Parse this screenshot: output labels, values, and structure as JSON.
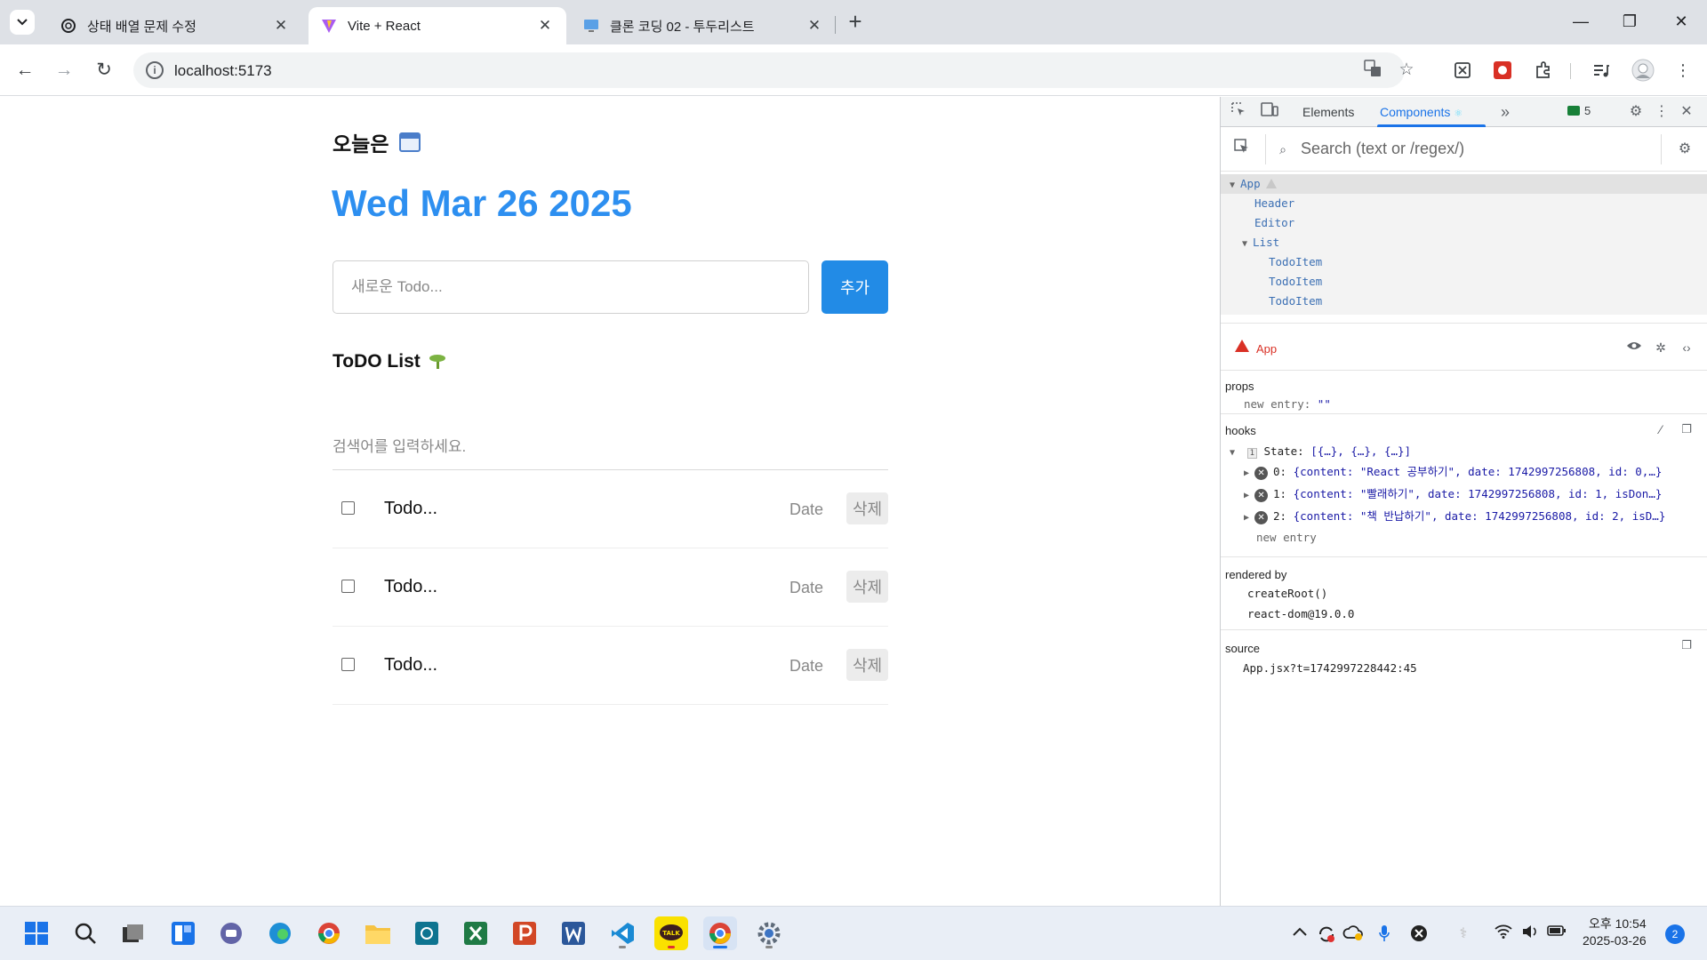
{
  "browser": {
    "tabs": [
      {
        "title": "상태 배열 문제 수정",
        "icon": "openai-icon"
      },
      {
        "title": "Vite + React",
        "icon": "vite-icon",
        "active": true
      },
      {
        "title": "클론 코딩 02 - 투두리스트",
        "icon": "monitor-icon"
      }
    ],
    "url": "localhost:5173"
  },
  "app": {
    "today_label": "오늘은",
    "date": "Wed Mar 26 2025",
    "editor": {
      "placeholder": "새로운 Todo...",
      "add_label": "추가"
    },
    "list_title": "ToDO List",
    "search_placeholder": "검색어를 입력하세요.",
    "todos": [
      {
        "content": "Todo...",
        "date": "Date",
        "delete_label": "삭제",
        "checked": false
      },
      {
        "content": "Todo...",
        "date": "Date",
        "delete_label": "삭제",
        "checked": false
      },
      {
        "content": "Todo...",
        "date": "Date",
        "delete_label": "삭제",
        "checked": false
      }
    ]
  },
  "devtools": {
    "tabs": [
      "Elements",
      "Components"
    ],
    "active_tab": "Components",
    "issues_count": "5",
    "search_placeholder": "Search (text or /regex/)",
    "tree": [
      {
        "name": "App",
        "depth": 0,
        "expanded": true
      },
      {
        "name": "Header",
        "depth": 1
      },
      {
        "name": "Editor",
        "depth": 1
      },
      {
        "name": "List",
        "depth": 1,
        "expanded": true
      },
      {
        "name": "TodoItem",
        "depth": 2
      },
      {
        "name": "TodoItem",
        "depth": 2
      },
      {
        "name": "TodoItem",
        "depth": 2
      }
    ],
    "selected": "App",
    "props_label": "props",
    "props_new_entry": "new entry:",
    "props_new_entry_value": "\"\"",
    "hooks_label": "hooks",
    "hook_index": "1",
    "hook_state": "State:",
    "hook_state_value": "[{…}, {…}, {…}]",
    "hook_items": [
      {
        "index": "0:",
        "value": "{content: \"React 공부하기\", date: 1742997256808, id: 0,…}"
      },
      {
        "index": "1:",
        "value": "{content: \"빨래하기\", date: 1742997256808, id: 1, isDon…}"
      },
      {
        "index": "2:",
        "value": "{content: \"책 반납하기\", date: 1742997256808, id: 2, isD…}"
      }
    ],
    "hooks_new_entry": "new entry",
    "rendered_by_label": "rendered by",
    "rendered_by": [
      "createRoot()",
      "react-dom@19.0.0"
    ],
    "source_label": "source",
    "source": "App.jsx?t=1742997228442:45"
  },
  "taskbar": {
    "time": "오후 10:54",
    "date": "2025-03-26",
    "notifications": "2"
  }
}
